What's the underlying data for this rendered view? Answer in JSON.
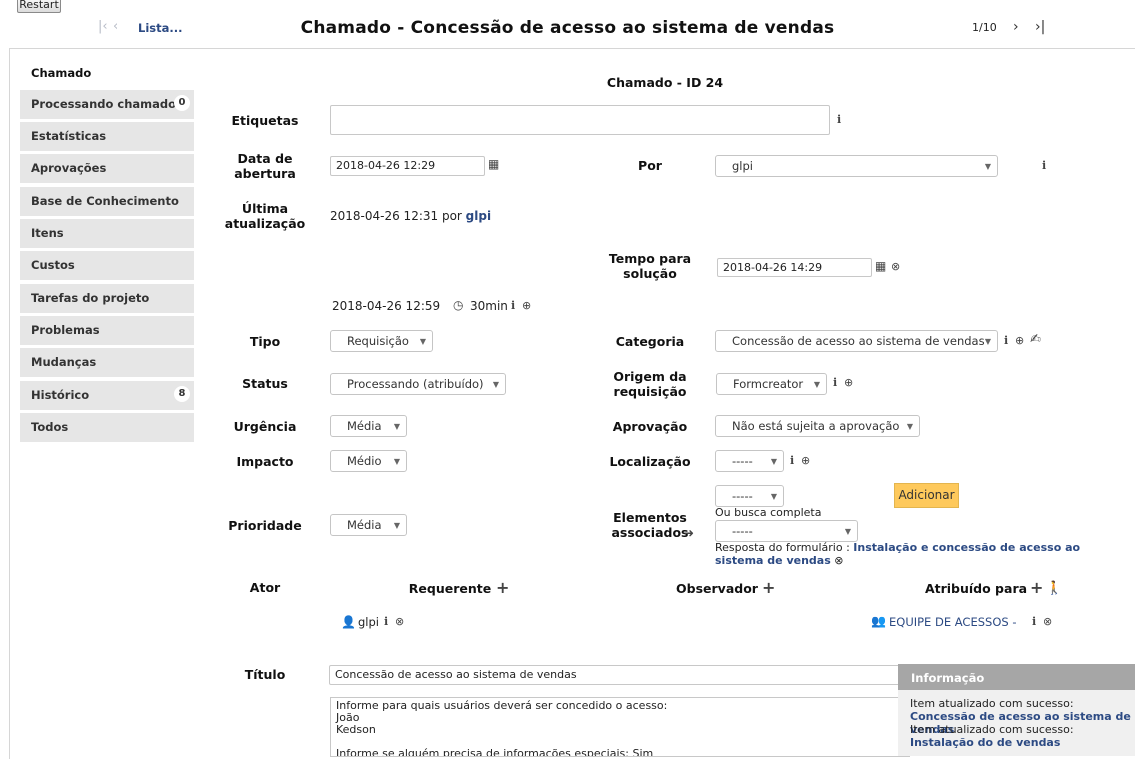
{
  "restart_label": "Restart",
  "nav": {
    "list_label": "Lista...",
    "title": "Chamado - Concessão de acesso ao sistema de vendas",
    "pager": "1/10"
  },
  "sidebar": {
    "active": "Chamado",
    "items": [
      {
        "label": "Processando chamado",
        "badge": "0"
      },
      {
        "label": "Estatísticas"
      },
      {
        "label": "Aprovações"
      },
      {
        "label": "Base de Conhecimento"
      },
      {
        "label": "Itens"
      },
      {
        "label": "Custos"
      },
      {
        "label": "Tarefas do projeto"
      },
      {
        "label": "Problemas"
      },
      {
        "label": "Mudanças"
      },
      {
        "label": "Histórico",
        "badge": "8"
      },
      {
        "label": "Todos"
      }
    ]
  },
  "form": {
    "header": "Chamado - ID 24",
    "labels": {
      "etiquetas": "Etiquetas",
      "data_abertura": "Data de abertura",
      "por": "Por",
      "ultima_atualizacao": "Última atualização",
      "tempo_solucao": "Tempo para solução",
      "tipo": "Tipo",
      "categoria": "Categoria",
      "status": "Status",
      "origem": "Origem da requisição",
      "urgencia": "Urgência",
      "aprovacao": "Aprovação",
      "impacto": "Impacto",
      "localizacao": "Localização",
      "prioridade": "Prioridade",
      "elementos": "Elementos associados",
      "ator": "Ator",
      "titulo": "Título"
    },
    "values": {
      "etiquetas": "",
      "data_abertura": "2018-04-26 12:29",
      "por": "glpi",
      "ultima_atualizacao_text": "2018-04-26 12:31 por",
      "ultima_atualizacao_user": "glpi",
      "tempo_solucao": "2018-04-26 14:29",
      "time_date": "2018-04-26 12:59",
      "time_duration": "30min",
      "tipo": "Requisição",
      "categoria": "Concessão de acesso ao sistema de vendas",
      "status": "Processando (atribuído)",
      "origem": "Formcreator",
      "urgencia": "Média",
      "aprovacao": "Não está sujeita a aprovação",
      "impacto": "Médio",
      "localizacao": "-----",
      "prioridade": "Média",
      "elementos_select": "-----",
      "busca_label": "Ou busca completa",
      "busca_select": "-----",
      "resposta_prefix": "Resposta do formulário :",
      "resposta_link": "Instalação e concessão de acesso ao sistema de vendas",
      "add_button": "Adicionar",
      "titulo": "Concessão de acesso ao sistema de vendas",
      "description": "Informe para quais usuários deverá ser concedido o acesso:\nJoão\nKedson\n\nInforme se alguém precisa de informações especiais: Sim"
    },
    "actors": {
      "requerente": "Requerente",
      "observador": "Observador",
      "atribuido": "Atribuído para",
      "requester_user": "glpi",
      "assigned_group": "EQUIPE DE ACESSOS -"
    }
  },
  "notification": {
    "title": "Informação",
    "line1_prefix": "Item atualizado com sucesso:",
    "line1_link": "Concessão de acesso ao sistema de vendas",
    "line2_prefix": "Item atualizado com sucesso:",
    "line2_link": "Instalação do de vendas"
  },
  "colors": {
    "accent": "#2c4a83",
    "add_button": "#fec95c",
    "tab_bg": "#e6e6e6",
    "notif_head": "#a6a6a6"
  }
}
